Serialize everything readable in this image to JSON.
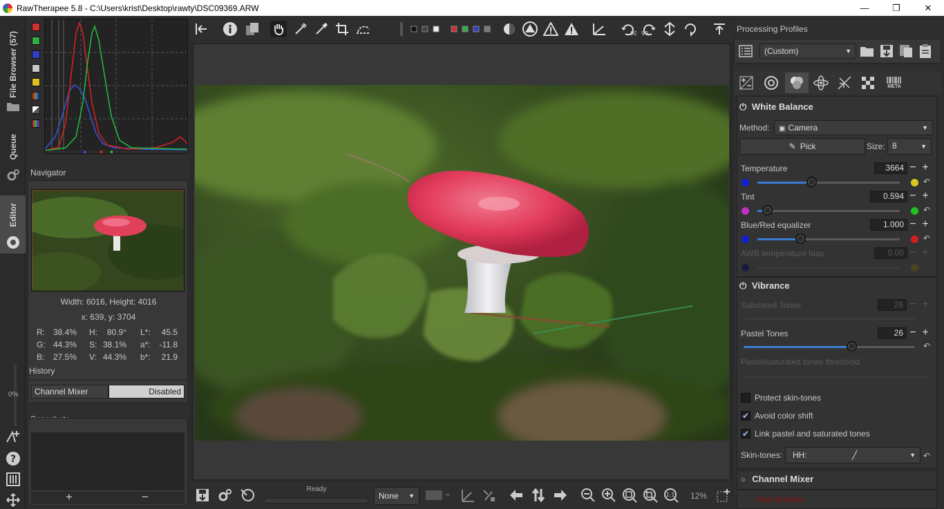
{
  "window": {
    "title": "RawTherapee 5.8 - C:\\Users\\krist\\Desktop\\rawty\\DSC09369.ARW",
    "minimize": "—",
    "maximize": "❐",
    "close": "✕"
  },
  "vtabs": {
    "file_browser": "File Browser (57)",
    "queue": "Queue",
    "editor": "Editor"
  },
  "left": {
    "navigator_title": "Navigator",
    "image_size": "Width: 6016, Height: 4016",
    "cursor_pos": "x: 639, y: 3704",
    "readout": {
      "R": "38.4%",
      "G": "44.3%",
      "B": "27.5%",
      "H": "80.9°",
      "S": "38.1%",
      "V": "44.3%",
      "L": "45.5",
      "a": "-11.8",
      "b": "21.9",
      "R_label": "R:",
      "G_label": "G:",
      "B_label": "B:",
      "H_label": "H:",
      "S_label": "S:",
      "V_label": "V:",
      "L_label": "L*:",
      "a_label": "a*:",
      "b_label": "b*:"
    },
    "history_title": "History",
    "history_item": {
      "name": "Channel Mixer",
      "value": "Disabled"
    },
    "snapshots_title": "Snapshots",
    "snap_add": "+",
    "snap_remove": "−",
    "zoom_pct": "0%"
  },
  "bottom": {
    "status": "Ready",
    "output_select": "None",
    "zoom": "12%"
  },
  "right": {
    "profiles_title": "Processing Profiles",
    "profile_value": "(Custom)",
    "white_balance": {
      "title": "White Balance",
      "method_label": "Method:",
      "method_value": "Camera",
      "pick_label": "Pick",
      "size_label": "Size:",
      "size_value": "8",
      "temperature_label": "Temperature",
      "temperature_value": "3664",
      "temperature_fraction": 0.38,
      "tint_label": "Tint",
      "tint_value": "0.594",
      "tint_fraction": 0.07,
      "bluered_label": "Blue/Red equalizer",
      "bluered_value": "1.000",
      "bluered_fraction": 0.3,
      "awb_label": "AWB temperature bias",
      "awb_value": "0.00"
    },
    "vibrance": {
      "title": "Vibrance",
      "saturated_label": "Saturated Tones",
      "saturated_value": "26",
      "pastel_label": "Pastel Tones",
      "pastel_value": "26",
      "pastel_fraction": 0.63,
      "threshold_label": "Pastel/saturated tones threshold",
      "protect_label": "Protect skin-tones",
      "protect_checked": false,
      "avoid_label": "Avoid color shift",
      "avoid_checked": true,
      "link_label": "Link pastel and saturated tones",
      "link_checked": true,
      "skin_label": "Skin-tones:",
      "skin_value": "HH:"
    },
    "channel_mixer": {
      "title": "Channel Mixer",
      "red_channel": "Red channel"
    },
    "tool_meta": "META"
  },
  "colors": {
    "accent": "#3b7cd1",
    "panel": "#2e2e2e"
  }
}
